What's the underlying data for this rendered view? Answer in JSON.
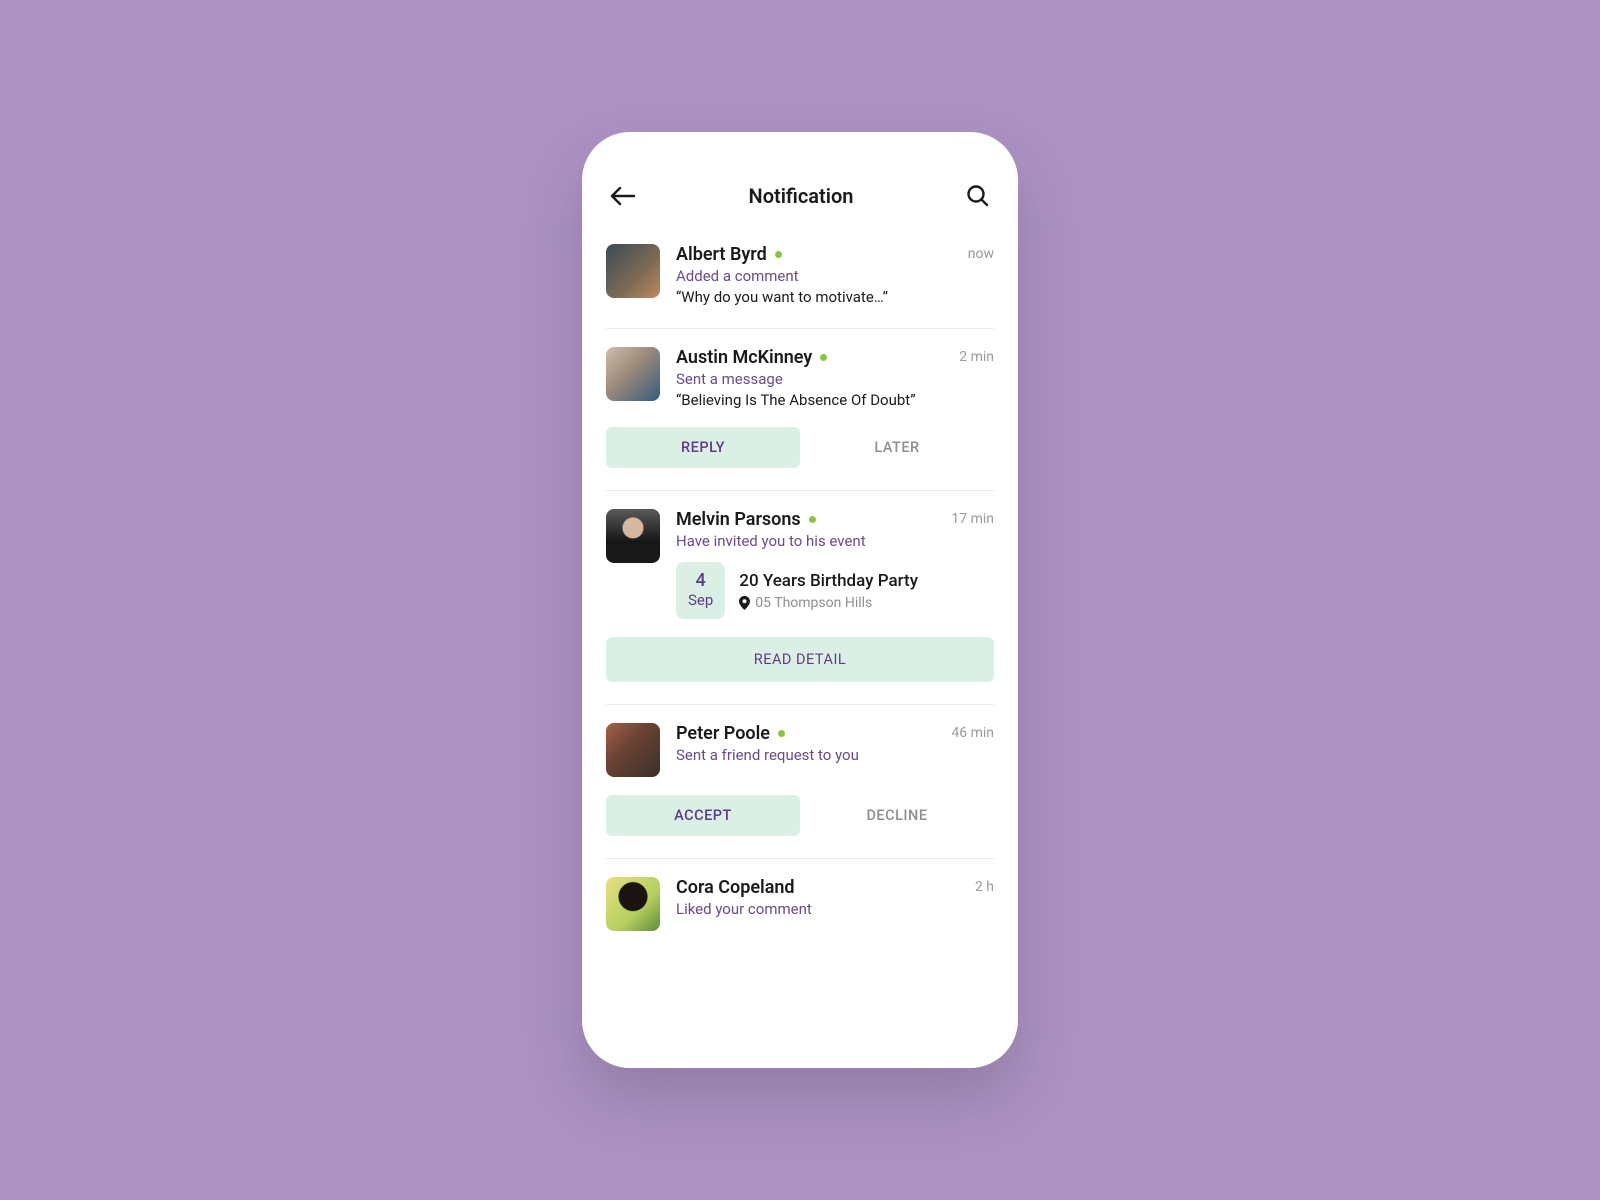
{
  "header": {
    "title": "Notification"
  },
  "items": [
    {
      "name": "Albert Byrd",
      "online": true,
      "action": "Added a comment",
      "quote": "“Why do you want to motivate…”",
      "time": "now"
    },
    {
      "name": "Austin McKinney",
      "online": true,
      "action": "Sent a message",
      "quote": "“Believing Is The Absence Of Doubt”",
      "time": "2 min",
      "buttons": {
        "primary": "REPLY",
        "secondary": "LATER"
      }
    },
    {
      "name": "Melvin Parsons",
      "online": true,
      "action": "Have invited you to his event",
      "time": "17 min",
      "event": {
        "day": "4",
        "month": "Sep",
        "title": "20 Years Birthday Party",
        "location": "05 Thompson Hills"
      },
      "detail": "READ DETAIL"
    },
    {
      "name": "Peter Poole",
      "online": true,
      "action": "Sent a friend request to you",
      "time": "46 min",
      "buttons": {
        "primary": "ACCEPT",
        "secondary": "DECLINE"
      }
    },
    {
      "name": "Cora Copeland",
      "online": false,
      "action": "Liked your comment",
      "time": "2 h"
    }
  ]
}
